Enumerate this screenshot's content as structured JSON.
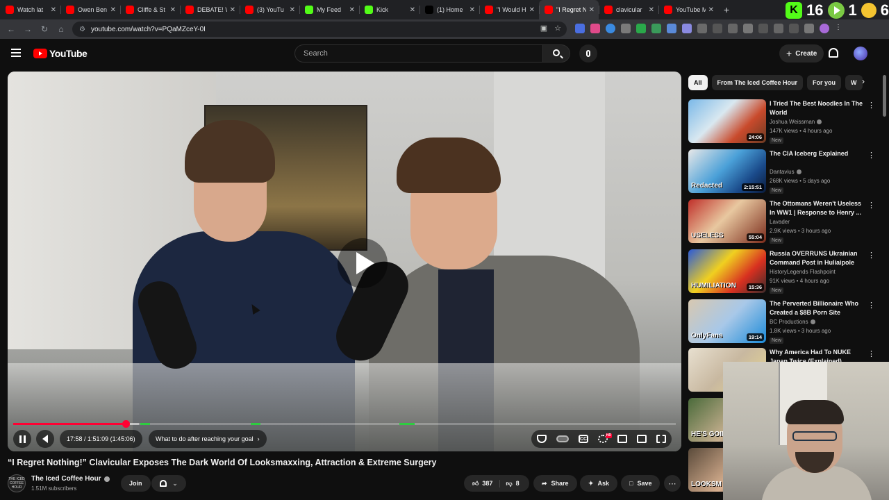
{
  "browser": {
    "tabs": [
      {
        "title": "Watch lat",
        "color": "#ff0000",
        "active": false
      },
      {
        "title": "Owen Ben",
        "color": "#ff0000",
        "active": false
      },
      {
        "title": "Cliffe & St",
        "color": "#ff0000",
        "active": false
      },
      {
        "title": "DEBATE! W",
        "color": "#ff0000",
        "active": false
      },
      {
        "title": "(3) YouTu",
        "color": "#ff0000",
        "active": false
      },
      {
        "title": "My Feed",
        "color": "#53fc18",
        "active": false
      },
      {
        "title": "Kick",
        "color": "#53fc18",
        "active": false
      },
      {
        "title": "(1) Home",
        "color": "#000000",
        "active": false
      },
      {
        "title": "\"I Would H",
        "color": "#ff0000",
        "active": false
      },
      {
        "title": "\"I Regret N",
        "color": "#ff0000",
        "active": true
      },
      {
        "title": "clavicular",
        "color": "#ff0000",
        "active": false
      },
      {
        "title": "YouTube M",
        "color": "#ff0000",
        "active": false
      }
    ],
    "url": "youtube.com/watch?v=PQaMZceY-0I",
    "ext_counters": {
      "first": "16",
      "second": "1",
      "third": "6"
    },
    "kick_letter": "K"
  },
  "yt": {
    "logo_text": "YouTube",
    "search_placeholder": "Search",
    "create_label": "Create"
  },
  "player": {
    "current_time": "17:58",
    "total_time": "1:51:09",
    "remaining": "(1:45:06)",
    "chapter": "What to do after reaching your goal",
    "progress_fraction": 0.17,
    "buffered_fraction": 0.19,
    "cc_label": "CC",
    "hd_badge": "HD"
  },
  "video": {
    "title": "“I Regret Nothing!” Clavicular Exposes The Dark World Of Looksmaxxing, Attraction & Extreme Surgery",
    "channel": "The Iced Coffee Hour",
    "channel_avatar_text": "THE ICED COFFEE HOUR",
    "subscribers": "1.51M subscribers",
    "join_label": "Join",
    "likes": "387",
    "dislikes": "8",
    "share_label": "Share",
    "ask_label": "Ask",
    "save_label": "Save"
  },
  "chips": [
    "All",
    "From The Iced Coffee Hour",
    "For you",
    "W"
  ],
  "recommendations": [
    {
      "title": "I Tried The Best Noodles In The World",
      "channel": "Joshua Weissman",
      "verified": true,
      "meta": "147K views • 4 hours ago",
      "badge": "New",
      "duration": "24:06",
      "thumb_text": "",
      "thumb_bg": "linear-gradient(135deg,#7ab8e8 0%,#d9e8f0 40%,#c94a2c 70%,#6a3a22 100%)"
    },
    {
      "title": "The CIA Iceberg Explained",
      "channel": "Dantavius",
      "verified": true,
      "meta": "268K views • 5 days ago",
      "badge": "New",
      "duration": "2:15:51",
      "thumb_text": "Redacted",
      "thumb_bg": "linear-gradient(135deg,#e8e8e8 0%,#4aa0d8 45%,#1a4a8a 75%,#0a1a3a 100%)"
    },
    {
      "title": "The Ottomans Weren't Useless In WW1 | Response to Henry ...",
      "channel": "Lavader",
      "verified": false,
      "meta": "2.9K views • 3 hours ago",
      "badge": "New",
      "duration": "55:04",
      "thumb_text": "USELESS",
      "thumb_bg": "linear-gradient(135deg,#c0302a 0%,#e8c8a0 45%,#7a2a1a 100%)"
    },
    {
      "title": "Russia OVERRUNS Ukrainian Command Post in Huliaipole",
      "channel": "HistoryLegends Flashpoint",
      "verified": false,
      "meta": "91K views • 4 hours ago",
      "badge": "New",
      "duration": "15:36",
      "thumb_text": "HUMILIATION",
      "thumb_bg": "linear-gradient(135deg,#2a5ad8 0%,#f0d020 40%,#d83020 70%,#3a2a2a 100%)"
    },
    {
      "title": "The Perverted Billionaire Who Created a $8B Porn Site",
      "channel": "BC Productions",
      "verified": true,
      "meta": "1.8K views • 3 hours ago",
      "badge": "New",
      "duration": "19:14",
      "thumb_text": "OnlyFans",
      "thumb_bg": "linear-gradient(135deg,#d8c8b0 0%,#a8c8e8 50%,#1a8ad8 100%)"
    },
    {
      "title": "Why America Had To NUKE Japan Twice (Explained)",
      "channel": "",
      "verified": false,
      "meta": "",
      "badge": "",
      "duration": "",
      "thumb_text": "",
      "thumb_bg": "linear-gradient(135deg,#e8e0d0 0%,#c8b8a0 50%,#e8d890 100%)"
    },
    {
      "title": "",
      "channel": "",
      "verified": false,
      "meta": "",
      "badge": "",
      "duration": "",
      "thumb_text": "HE'S GOIN",
      "thumb_bg": "linear-gradient(135deg,#4a6a3a 0%,#c8b090 60%,#2a2a2a 100%)"
    },
    {
      "title": "",
      "channel": "",
      "verified": false,
      "meta": "",
      "badge": "",
      "duration": "",
      "thumb_text": "LOOKSM",
      "thumb_bg": "linear-gradient(135deg,#5a4a3a 0%,#d8b090 60%,#1a1a2a 100%)"
    }
  ],
  "colors": {
    "accent": "#ff0033",
    "bg": "#0f0f0f",
    "chip_bg": "#272727"
  }
}
